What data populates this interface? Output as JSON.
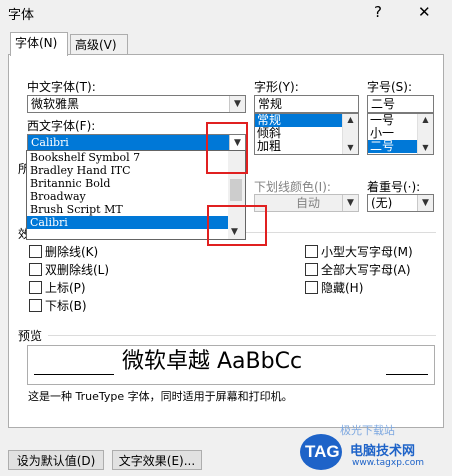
{
  "window": {
    "title": "字体",
    "help": "?",
    "close": "✕"
  },
  "tabs": [
    {
      "label": "字体(N)",
      "active": true
    },
    {
      "label": "高级(V)",
      "active": false
    }
  ],
  "chinese_font": {
    "label": "中文字体(T):",
    "value": "微软雅黑"
  },
  "style": {
    "label": "字形(Y):",
    "value": "常规",
    "options": [
      "常规",
      "倾斜",
      "加粗"
    ],
    "selected": 0
  },
  "size": {
    "label": "字号(S):",
    "value": "二号",
    "options": [
      "一号",
      "小一",
      "二号"
    ],
    "selected": 2
  },
  "western_font": {
    "label": "西文字体(F):",
    "value": "Calibri"
  },
  "dropdown": {
    "items": [
      "Bookshelf Symbol 7",
      "Bradley Hand ITC",
      "Britannic Bold",
      "Broadway",
      "Brush Script MT",
      "Calibri"
    ],
    "selected": 5
  },
  "all_text_label_partial": "所",
  "underline_color": {
    "label": "下划线颜色(I):",
    "value": "自动"
  },
  "emphasis": {
    "label": "着重号(·):",
    "value": "(无)"
  },
  "effects_label_partial": "效",
  "effects_left": [
    "删除线(K)",
    "双删除线(L)",
    "上标(P)",
    "下标(B)"
  ],
  "effects_right": [
    "小型大写字母(M)",
    "全部大写字母(A)",
    "隐藏(H)"
  ],
  "preview": {
    "label": "预览",
    "sample": "微软卓越  AaBbCc"
  },
  "note": "这是一种 TrueType 字体，同时适用于屏幕和打印机。",
  "buttons": {
    "default": "设为默认值(D)",
    "text_effects": "文字效果(E)..."
  },
  "watermark": {
    "brand": "TAG",
    "line1": "电脑技术网",
    "line2": "www.tagxp.com",
    "partial": "极光下载站"
  },
  "colors": {
    "accent": "#0078d7",
    "highlight_box": "#e02020",
    "watermark_blue": "#1e63c8"
  },
  "icons": [
    "chevron-down-icon",
    "scroll-up-icon",
    "scroll-down-icon",
    "checkbox-icon"
  ]
}
